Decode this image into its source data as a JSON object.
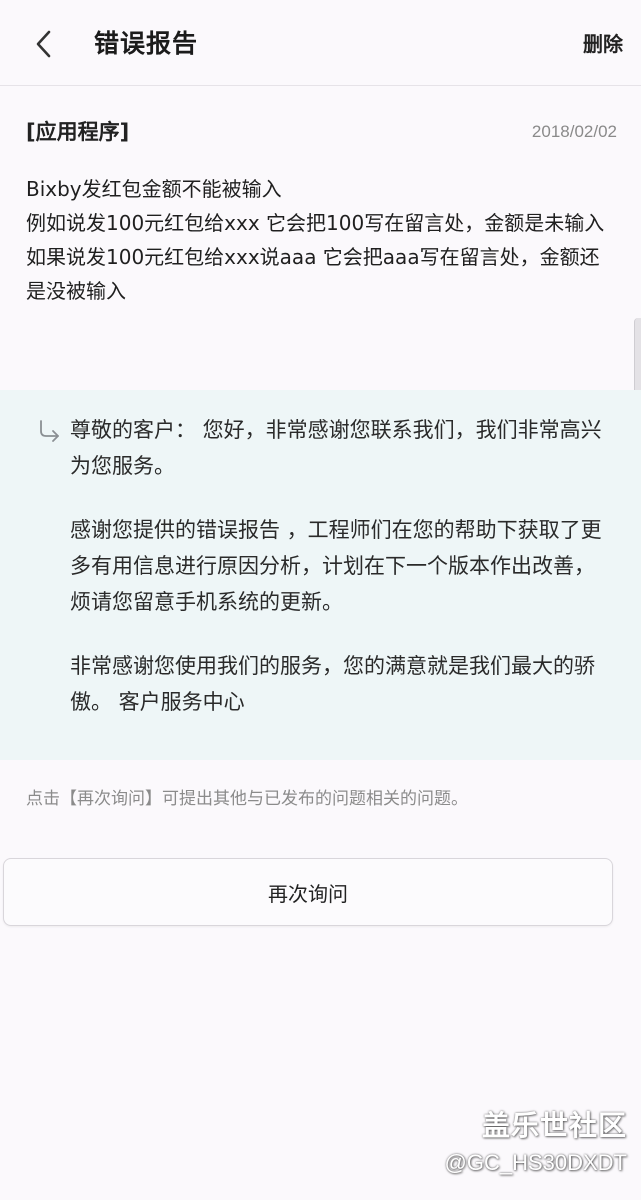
{
  "header": {
    "title": "错误报告",
    "delete_label": "删除",
    "back_icon": "chevron-left-icon"
  },
  "report": {
    "category": "[应用程序]",
    "date": "2018/02/02",
    "lines": [
      "Bixby发红包金额不能被输入",
      "例如说发100元红包给xxx 它会把100写在留言处，金额是未输入",
      "如果说发100元红包给xxx说aaa 它会把aaa写在留言处，金额还是没被输入"
    ]
  },
  "reply": {
    "icon": "reply-arrow-icon",
    "paragraphs": [
      "尊敬的客户： 您好，非常感谢您联系我们，我们非常高兴为您服务。",
      "感谢您提供的错误报告 ，工程师们在您的帮助下获取了更多有用信息进行原因分析，计划在下一个版本作出改善，烦请您留意手机系统的更新。",
      "非常感谢您使用我们的服务，您的满意就是我们最大的骄傲。 客户服务中心"
    ]
  },
  "hint": "点击【再次询问】可提出其他与已发布的问题相关的问题。",
  "reask_button": "再次询问",
  "watermark": {
    "logo": "盖乐世社区",
    "user": "@GC_HS30DXDT"
  },
  "colors": {
    "background": "#fbf9fc",
    "reply_background": "#eef6f7",
    "muted_text": "#8b8b8b"
  }
}
